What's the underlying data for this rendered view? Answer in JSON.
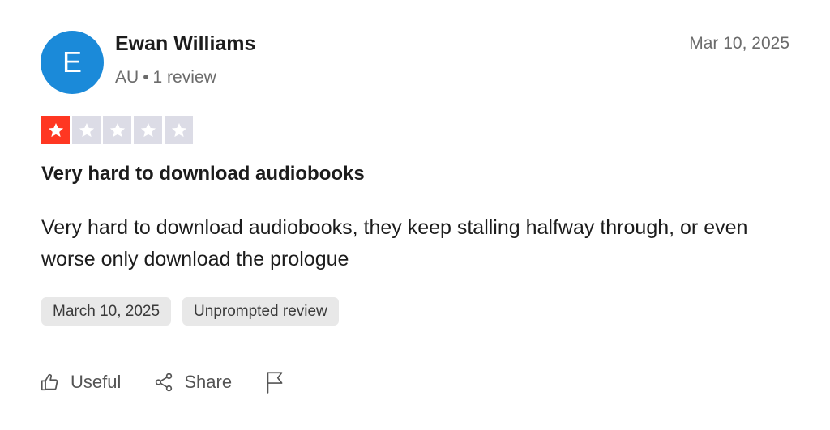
{
  "reviewer": {
    "initial": "E",
    "name": "Ewan Williams",
    "country": "AU",
    "separator": "•",
    "review_count": "1 review",
    "avatar_color": "#1b8ad9"
  },
  "review": {
    "date": "Mar 10, 2025",
    "rating": 1,
    "max_rating": 5,
    "title": "Very hard to download audiobooks",
    "body": "Very hard to download audiobooks, they keep stalling halfway through, or even worse only download the prologue",
    "tags": {
      "experience_date": "March 10, 2025",
      "review_type": "Unprompted review"
    }
  },
  "actions": {
    "useful_label": "Useful",
    "share_label": "Share"
  },
  "colors": {
    "star_filled": "#ff3722",
    "star_empty": "#dcdce6",
    "tag_bg": "#e8e8e8",
    "muted_text": "#6b6b6b"
  },
  "icons": {
    "useful": "thumbs-up-icon",
    "share": "share-icon",
    "report": "flag-icon",
    "star": "star-icon"
  }
}
